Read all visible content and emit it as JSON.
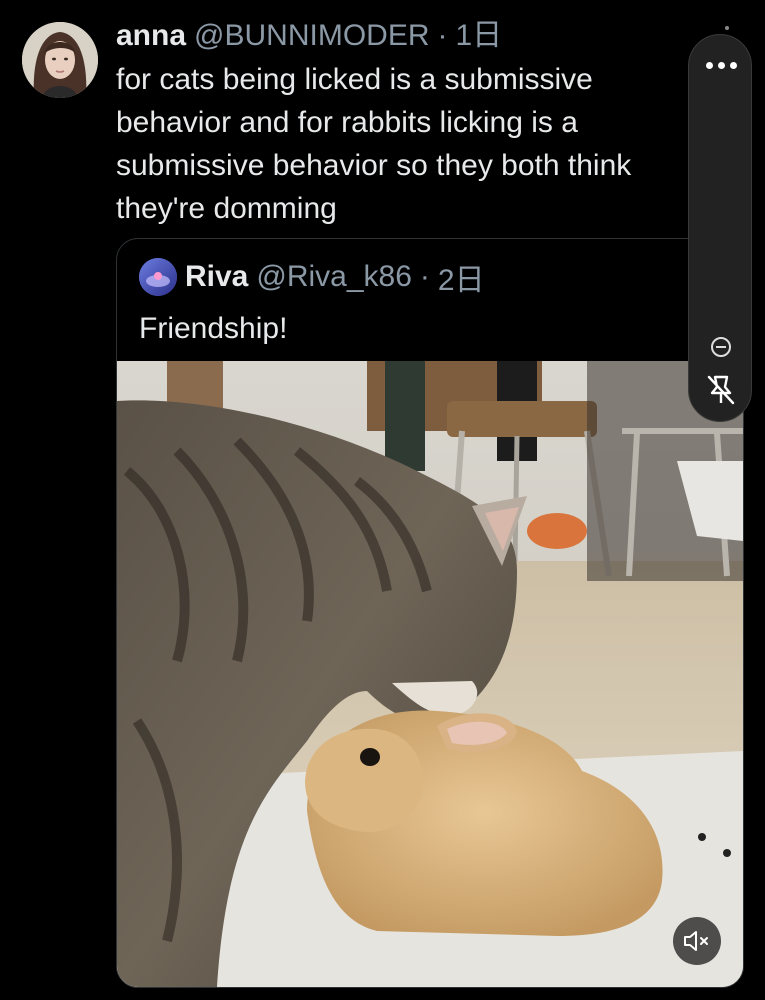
{
  "tweet": {
    "author_name": "anna",
    "handle": "@BUNNIMODER",
    "separator": "·",
    "time": "1日",
    "text": "for cats being licked is a submissive behavior and for rabbits licking is a submissive behavior so they both think they're domming"
  },
  "quote": {
    "author_name": "Riva",
    "handle": "@Riva_k86",
    "separator": "·",
    "time": "2日",
    "text": "Friendship!"
  },
  "media": {
    "description_icon": "video-mute-icon"
  },
  "side_toolbar": {
    "more_icon": "more-horizontal-icon",
    "minus_icon": "zoom-out-icon",
    "pin_icon": "unpin-icon"
  }
}
